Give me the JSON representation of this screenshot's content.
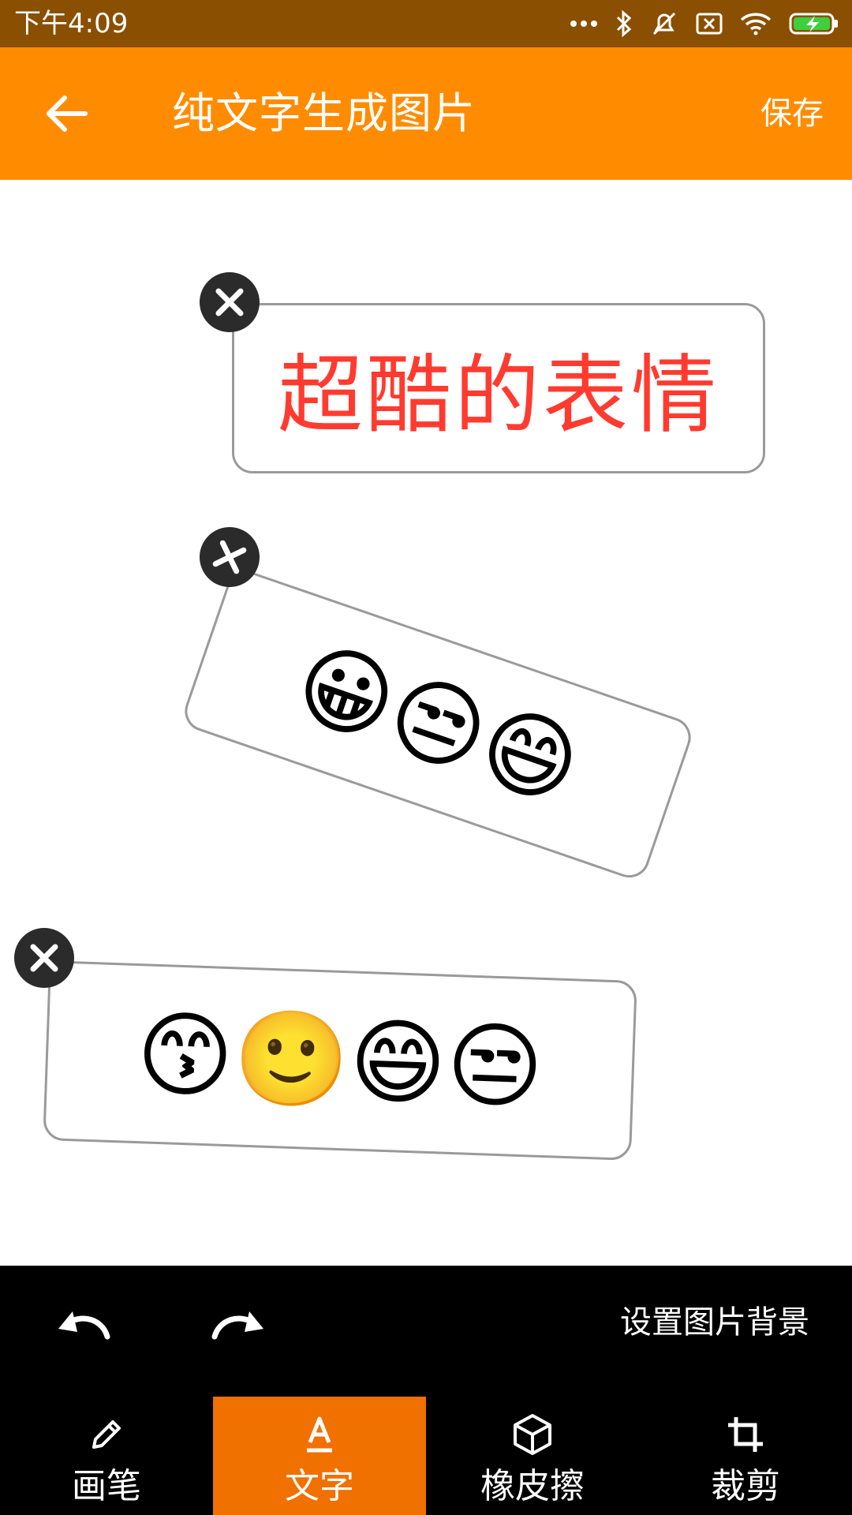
{
  "status_bar": {
    "time": "下午4:09",
    "icons": [
      "more-dots-icon",
      "bluetooth-icon",
      "mute-icon",
      "sim-off-icon",
      "wifi-icon",
      "battery-charging-icon"
    ],
    "battery_color": "#3ecf3e"
  },
  "header": {
    "title": "纯文字生成图片",
    "save_label": "保存",
    "bg_color": "#ff8c00"
  },
  "canvas": {
    "stickers": [
      {
        "type": "text",
        "text": "超酷的表情",
        "color": "#ff3b30"
      },
      {
        "type": "emoji",
        "text": "😀😒😄"
      },
      {
        "type": "emoji",
        "text": "😙🙂😄😒"
      }
    ]
  },
  "toolbar": {
    "set_background_label": "设置图片背景"
  },
  "tabs": [
    {
      "label": "画笔",
      "icon": "pencil-icon",
      "active": false
    },
    {
      "label": "文字",
      "icon": "text-a-icon",
      "active": true
    },
    {
      "label": "橡皮擦",
      "icon": "eraser-cube-icon",
      "active": false
    },
    {
      "label": "裁剪",
      "icon": "crop-icon",
      "active": false
    }
  ],
  "colors": {
    "status_bar": "#8a4f00",
    "accent": "#ff8c00",
    "active_tab": "#f07000",
    "toolbar_bg": "#000000"
  }
}
